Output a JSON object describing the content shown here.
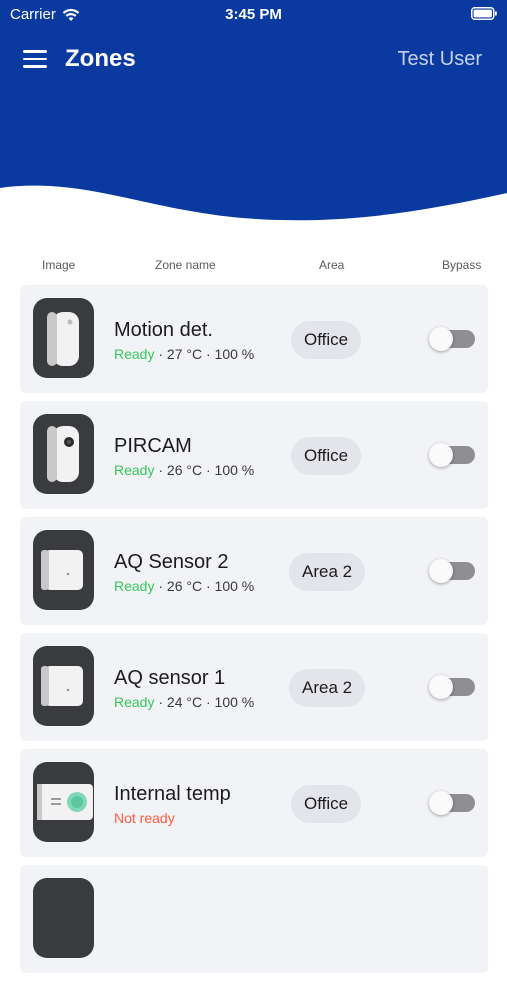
{
  "status_bar": {
    "carrier": "Carrier",
    "time": "3:45 PM"
  },
  "header": {
    "title": "Zones",
    "user": "Test User"
  },
  "columns": {
    "image": "Image",
    "zone_name": "Zone name",
    "area": "Area",
    "bypass": "Bypass"
  },
  "colors": {
    "header_blue": "#0a3aa0",
    "ready": "#34c759",
    "not_ready": "#ff5a3c"
  },
  "zones": [
    {
      "name": "Motion det.",
      "status": "Ready",
      "temp": "27 °C",
      "level": "100 %",
      "area": "Office",
      "bypass": false,
      "device": "motion-detector-icon"
    },
    {
      "name": "PIRCAM",
      "status": "Ready",
      "temp": "26 °C",
      "level": "100 %",
      "area": "Office",
      "bypass": false,
      "device": "pir-camera-icon"
    },
    {
      "name": "AQ Sensor 2",
      "status": "Ready",
      "temp": "26 °C",
      "level": "100 %",
      "area": "Area 2",
      "bypass": false,
      "device": "air-quality-sensor-icon"
    },
    {
      "name": "AQ sensor 1",
      "status": "Ready",
      "temp": "24 °C",
      "level": "100 %",
      "area": "Area 2",
      "bypass": false,
      "device": "air-quality-sensor-icon"
    },
    {
      "name": "Internal temp",
      "status": "Not ready",
      "area": "Office",
      "bypass": false,
      "device": "control-panel-icon"
    }
  ]
}
